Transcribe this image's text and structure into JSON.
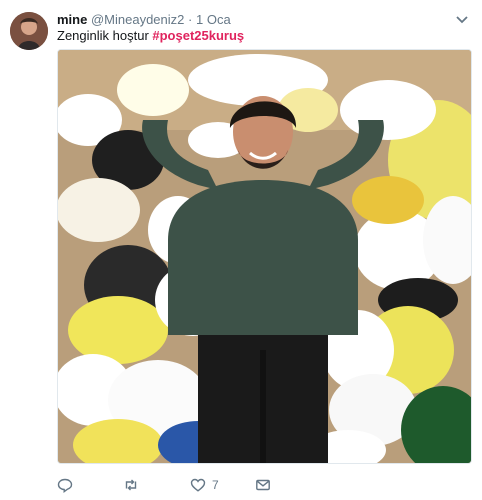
{
  "tweet": {
    "author_name": "mine",
    "author_handle": "@Mineaydeniz2",
    "separator": "·",
    "date": "1 Oca",
    "text_prefix": "Zenginlik hoştur ",
    "hashtag": "#poşet25kuruş"
  },
  "actions": {
    "reply_count": "",
    "retweet_count": "",
    "like_count": "7",
    "dm_label": ""
  },
  "colors": {
    "hashtag": "#e0245e",
    "secondary_text": "#657786",
    "primary_text": "#14171a"
  },
  "icons": [
    "reply-icon",
    "retweet-icon",
    "like-icon",
    "direct-message-icon",
    "chevron-down-icon"
  ]
}
